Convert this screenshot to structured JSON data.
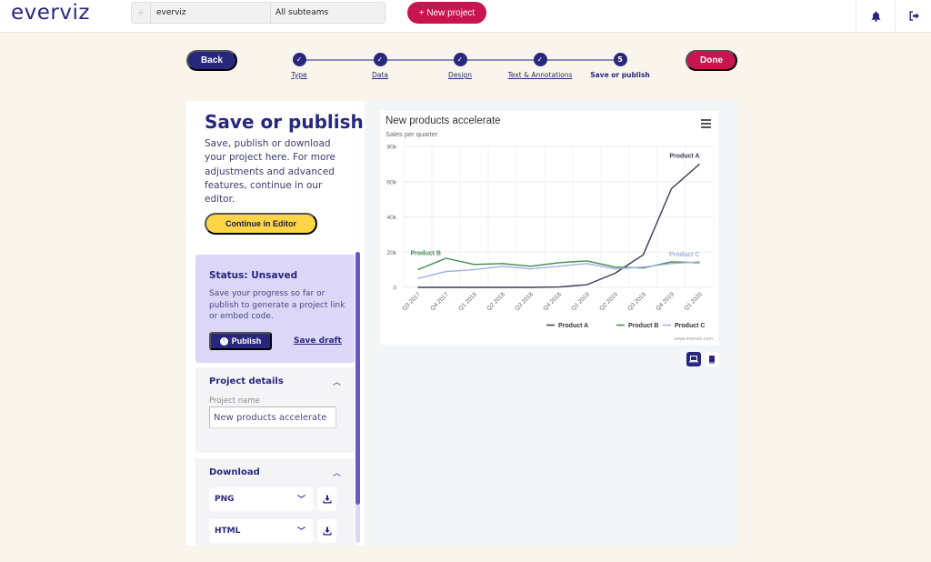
{
  "app": {
    "logo": "everviz",
    "team_plus": "+",
    "team": "everviz",
    "subteam": "All subteams",
    "new_project_label": "+ New project",
    "icons": [
      "bell-icon",
      "logout-icon"
    ]
  },
  "stepper": {
    "back_label": "Back",
    "done_label": "Done",
    "steps": [
      {
        "label": "Type",
        "state": "done",
        "marker": "✓"
      },
      {
        "label": "Data",
        "state": "done",
        "marker": "✓"
      },
      {
        "label": "Design",
        "state": "done",
        "marker": "✓"
      },
      {
        "label": "Text & Annotations",
        "state": "done",
        "marker": "✓"
      },
      {
        "label": "Save or publish",
        "state": "current",
        "marker": "5"
      }
    ]
  },
  "left": {
    "title": "Save or publish",
    "description": "Save, publish or download your project here. For more adjustments and advanced features, continue in our editor.",
    "continue_label": "Continue in Editor",
    "status": {
      "title": "Status: Unsaved",
      "description": "Save your progress so far or publish to generate a project link or embed code.",
      "publish_label": "Publish",
      "save_draft_label": "Save draft"
    },
    "project_details": {
      "heading": "Project details",
      "name_label": "Project name",
      "name_value": "New products accelerate"
    },
    "download": {
      "heading": "Download",
      "formats": [
        "PNG",
        "HTML"
      ]
    }
  },
  "preview": {
    "credit": "www.everviz.com",
    "view_modes": [
      "desktop",
      "mobile"
    ],
    "active_view": "desktop"
  },
  "chart_data": {
    "type": "line",
    "title": "New products accelerate",
    "subtitle": "Sales per quarter",
    "xlabel": "",
    "ylabel": "",
    "ylim": [
      0,
      80000
    ],
    "yticks": [
      0,
      20000,
      40000,
      60000,
      80000
    ],
    "ytick_labels": [
      "0",
      "20k",
      "40k",
      "60k",
      "80k"
    ],
    "grid": true,
    "legend": "bottom-right",
    "categories": [
      "Q3 2017",
      "Q4 2017",
      "Q1 2018",
      "Q2 2018",
      "Q3 2018",
      "Q4 2018",
      "Q1 2019",
      "Q2 2019",
      "Q3 2019",
      "Q4 2019",
      "Q1 2020"
    ],
    "series": [
      {
        "name": "Product A",
        "color": "#3a3956",
        "values": [
          0,
          0,
          0,
          0,
          0,
          200,
          1500,
          8000,
          18500,
          56000,
          70000
        ],
        "label_at": "end"
      },
      {
        "name": "Product B",
        "color": "#3f8a4e",
        "values": [
          10000,
          16500,
          13000,
          13500,
          12000,
          14000,
          15000,
          11500,
          11000,
          14500,
          14000
        ],
        "label_at": "start"
      },
      {
        "name": "Product C",
        "color": "#9eb1e0",
        "values": [
          5000,
          9000,
          10000,
          12000,
          10500,
          12000,
          13500,
          10500,
          11500,
          13500,
          14500
        ],
        "label_at": "end"
      }
    ]
  }
}
